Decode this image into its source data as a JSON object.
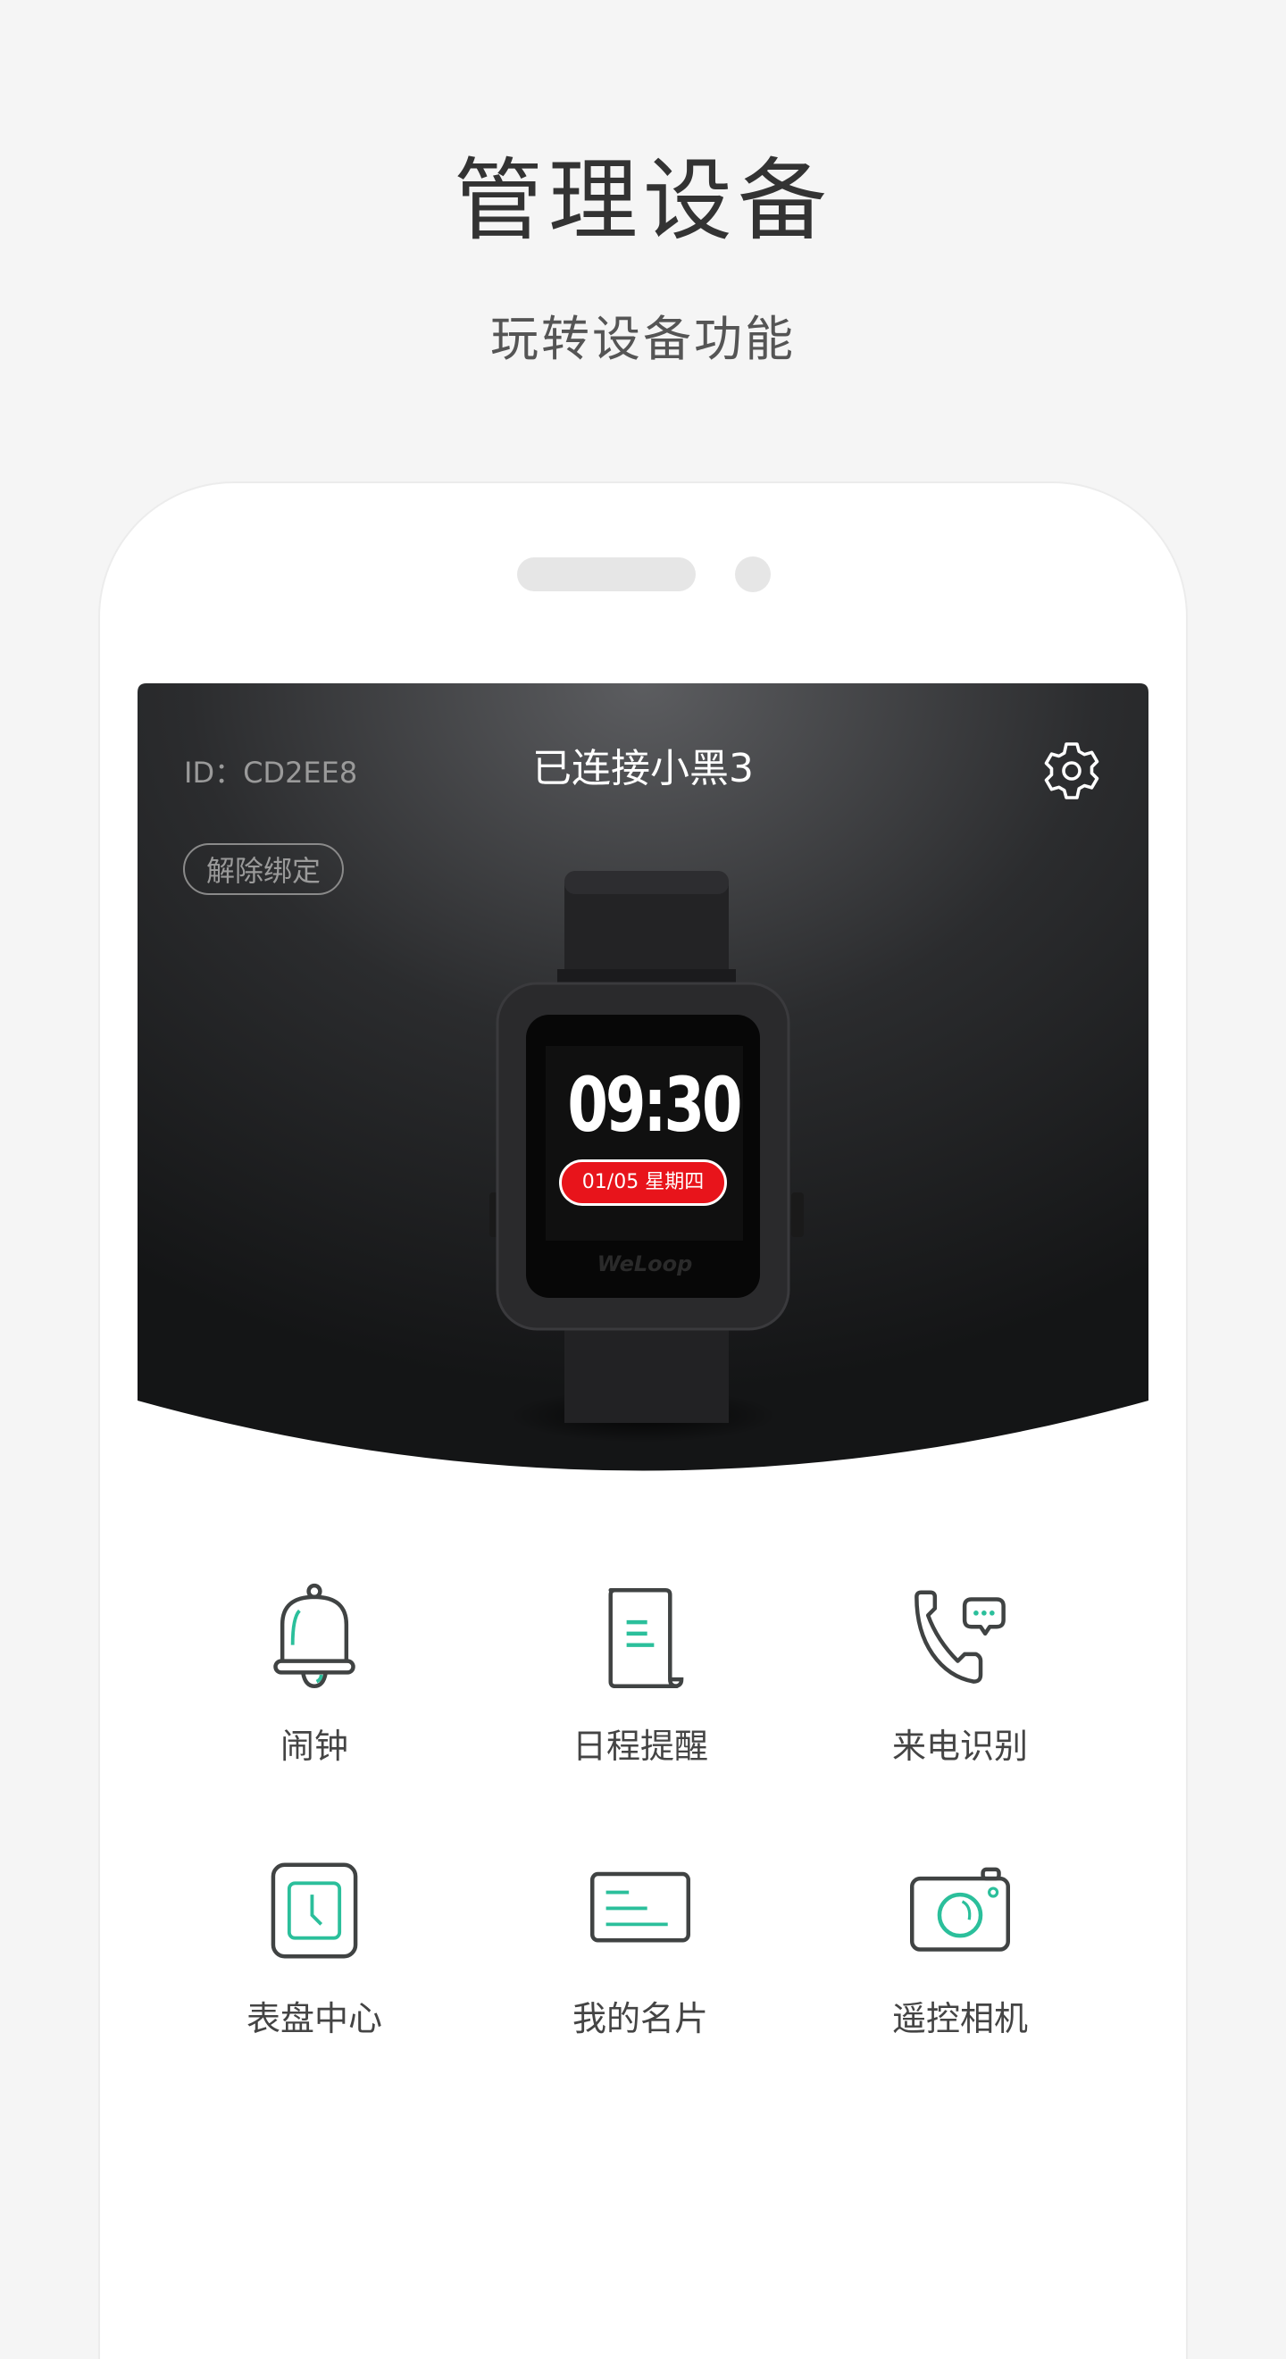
{
  "header": {
    "title": "管理设备",
    "subtitle": "玩转设备功能"
  },
  "device": {
    "id_label": "ID：CD2EE8",
    "title": "已连接小黑3",
    "unbind_label": "解除绑定",
    "settings_icon": "gear-icon",
    "watch_face": {
      "time": "09:30",
      "date": "01/05  星期四",
      "brand": "WeLoop"
    }
  },
  "features": [
    {
      "label": "闹钟",
      "icon": "bell-icon"
    },
    {
      "label": "日程提醒",
      "icon": "document-icon"
    },
    {
      "label": "来电识别",
      "icon": "phone-call-icon"
    },
    {
      "label": "表盘中心",
      "icon": "watch-face-icon"
    },
    {
      "label": "我的名片",
      "icon": "card-icon"
    },
    {
      "label": "遥控相机",
      "icon": "camera-icon"
    }
  ],
  "colors": {
    "accent": "#2bbf9b",
    "icon_stroke": "#404343",
    "card_dark": "#1e1f21",
    "date_red": "#e8141b"
  }
}
